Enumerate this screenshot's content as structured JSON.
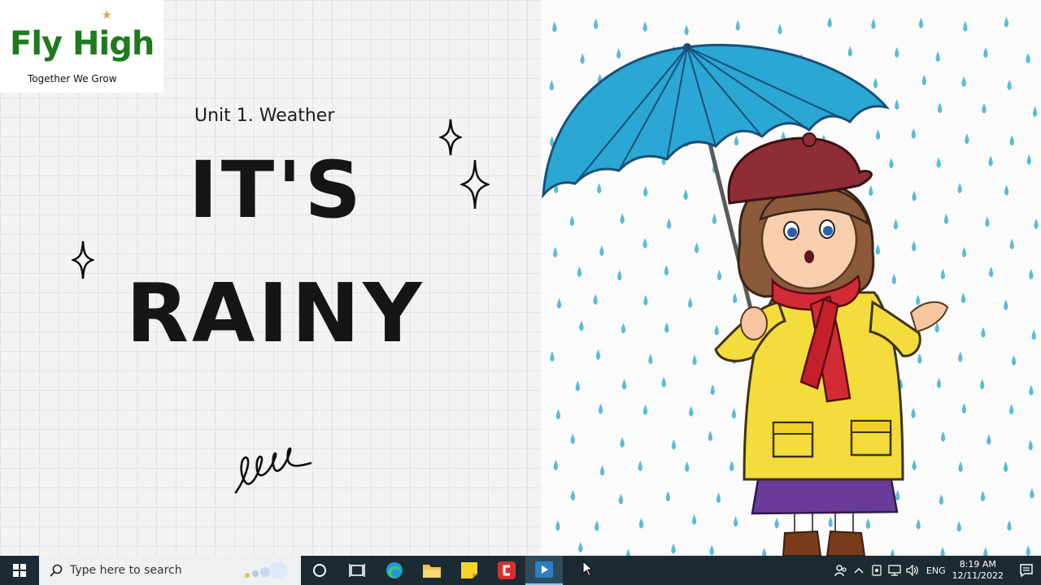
{
  "logo": {
    "name": "Fly High",
    "tagline": "Together We Grow",
    "brand_color": "#1f7a1f",
    "star_color": "#e0a23a"
  },
  "slide": {
    "unit_label": "Unit 1. Weather",
    "title_line1": "IT'S",
    "title_line2": "RAINY",
    "illustration": "girl-with-umbrella-in-rain"
  },
  "taskbar": {
    "search_placeholder": "Type here to search",
    "pinned_icons": [
      "task-view-icon",
      "edge-icon",
      "file-explorer-icon",
      "sticky-notes-icon",
      "camtasia-icon",
      "media-player-icon"
    ],
    "tray": {
      "language": "ENG",
      "time": "8:19 AM",
      "date": "12/11/2022"
    }
  }
}
